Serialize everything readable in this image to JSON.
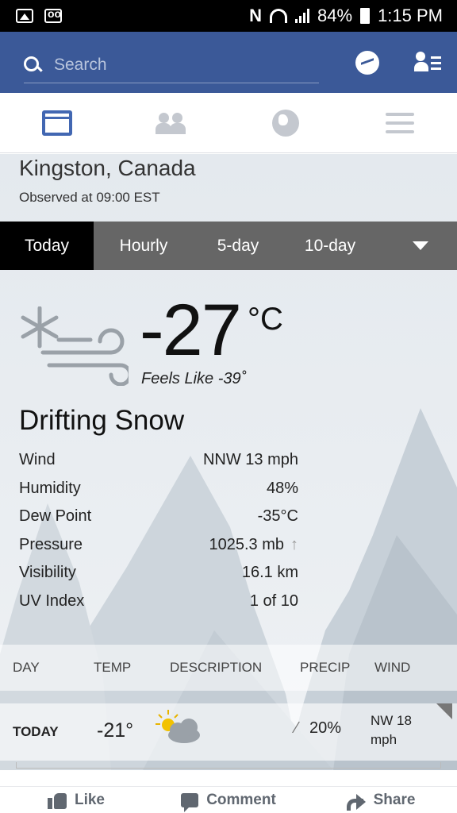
{
  "status_bar": {
    "battery": "84%",
    "time": "1:15 PM",
    "icons": [
      "gallery-icon",
      "voicemail-icon",
      "nfc-icon",
      "wifi-icon",
      "signal-icon",
      "battery-icon"
    ]
  },
  "header": {
    "search_placeholder": "Search",
    "icons": [
      "search-icon",
      "messenger-icon",
      "friend-requests-icon"
    ]
  },
  "nav": {
    "tabs": [
      "newsfeed-icon",
      "friends-icon",
      "globe-icon",
      "menu-icon"
    ]
  },
  "weather": {
    "city": "Kingston, Canada",
    "observed": "Observed at 09:00 EST",
    "tabs": [
      "Today",
      "Hourly",
      "5-day",
      "10-day"
    ],
    "active_tab": "Today",
    "temperature": "-27",
    "temp_unit": "°C",
    "feels_like": "Feels Like -39˚",
    "condition": "Drifting Snow",
    "condition_icon": "snow-wind-icon",
    "details": [
      {
        "label": "Wind",
        "value": "NNW 13 mph"
      },
      {
        "label": "Humidity",
        "value": "48%"
      },
      {
        "label": "Dew Point",
        "value": "-35°C"
      },
      {
        "label": "Pressure",
        "value": "1025.3 mb"
      },
      {
        "label": "Visibility",
        "value": "16.1 km"
      },
      {
        "label": "UV Index",
        "value": "1 of 10"
      }
    ],
    "pressure_trend": "↑",
    "forecast_headers": [
      "DAY",
      "TEMP",
      "DESCRIPTION",
      "PRECIP",
      "WIND"
    ],
    "forecast_row": {
      "day": "TODAY",
      "temp": "-21°",
      "precip": "20%",
      "wind_line1": "NW 18",
      "wind_line2": "mph",
      "icon": "partly-cloudy-icon"
    }
  },
  "actions": [
    "Like",
    "Comment",
    "Share"
  ]
}
